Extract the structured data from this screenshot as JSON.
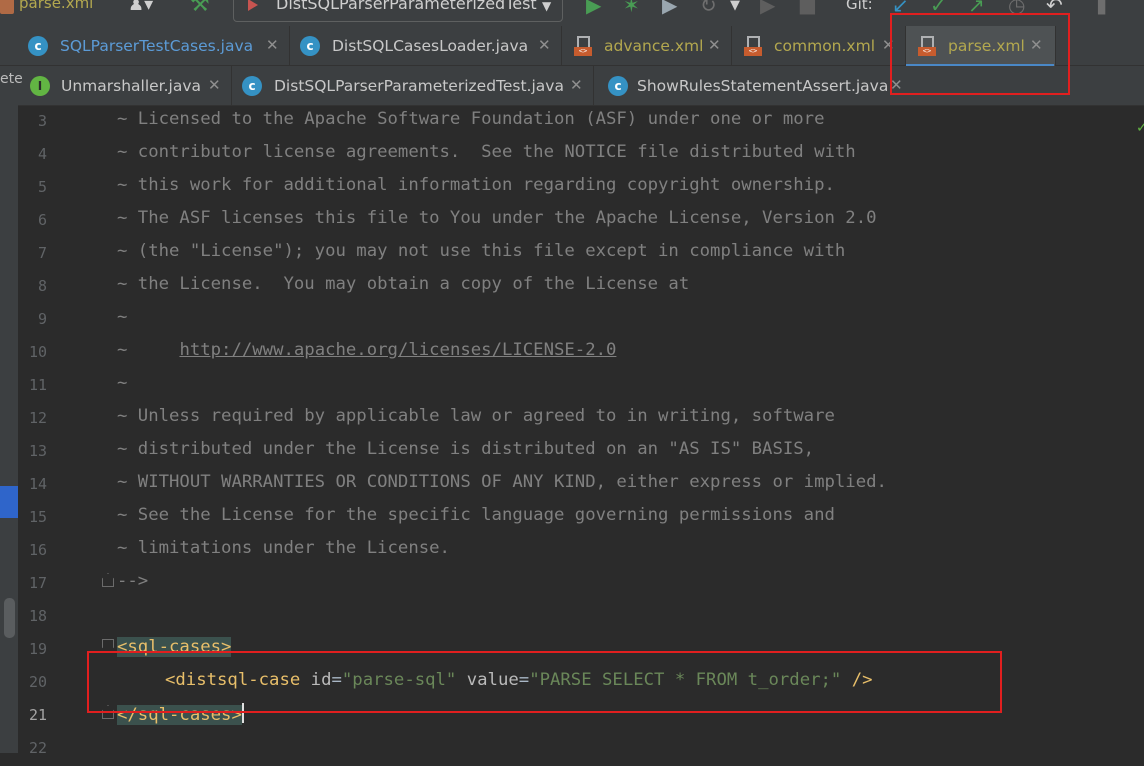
{
  "toolbar": {
    "file_label": "parse.xml",
    "run_config": "DistSQLParserParameterizedTest",
    "git_label": "Git:"
  },
  "tabs_row1": [
    {
      "label": "SQLParserTestCases.java",
      "icon": "java-class-icon",
      "color": "#5c9bd6"
    },
    {
      "label": "DistSQLCasesLoader.java",
      "icon": "java-class-icon",
      "color": "#c8c8c8"
    },
    {
      "label": "advance.xml",
      "icon": "xml-file-icon",
      "color": "#b3a84f"
    },
    {
      "label": "common.xml",
      "icon": "xml-file-icon",
      "color": "#b3a84f"
    },
    {
      "label": "parse.xml",
      "icon": "xml-file-icon",
      "color": "#b3a84f",
      "active": true
    }
  ],
  "tabs_row2": [
    {
      "label": "Unmarshaller.java",
      "icon": "java-interface-icon",
      "color": "#c8c8c8"
    },
    {
      "label": "DistSQLParserParameterizedTest.java",
      "icon": "java-test-class-icon",
      "color": "#c8c8c8"
    },
    {
      "label": "ShowRulesStatementAssert.java",
      "icon": "java-class-icon",
      "color": "#c8c8c8"
    }
  ],
  "side_strip_label": "ete",
  "editor": {
    "current_line": 21,
    "lines": [
      {
        "n": "3",
        "text": "~ Licensed to the Apache Software Foundation (ASF) under one or more"
      },
      {
        "n": "4",
        "text": "~ contributor license agreements.  See the NOTICE file distributed with"
      },
      {
        "n": "5",
        "text": "~ this work for additional information regarding copyright ownership."
      },
      {
        "n": "6",
        "text": "~ The ASF licenses this file to You under the Apache License, Version 2.0"
      },
      {
        "n": "7",
        "text": "~ (the \"License\"); you may not use this file except in compliance with"
      },
      {
        "n": "8",
        "text": "~ the License.  You may obtain a copy of the License at"
      },
      {
        "n": "9",
        "text": "~"
      },
      {
        "n": "10",
        "prefix": "~     ",
        "link": "http://www.apache.org/licenses/LICENSE-2.0"
      },
      {
        "n": "11",
        "text": "~"
      },
      {
        "n": "12",
        "text": "~ Unless required by applicable law or agreed to in writing, software"
      },
      {
        "n": "13",
        "text": "~ distributed under the License is distributed on an \"AS IS\" BASIS,"
      },
      {
        "n": "14",
        "text": "~ WITHOUT WARRANTIES OR CONDITIONS OF ANY KIND, either express or implied."
      },
      {
        "n": "15",
        "text": "~ See the License for the specific language governing permissions and"
      },
      {
        "n": "16",
        "text": "~ limitations under the License."
      },
      {
        "n": "17",
        "text": "-->"
      },
      {
        "n": "18",
        "text": ""
      },
      {
        "n": "19",
        "open_tag": "<sql-cases>"
      },
      {
        "n": "20",
        "case_open": "<distsql-case",
        "attr1": "id",
        "val1": "\"parse-sql\"",
        "attr2": "value",
        "val2": "\"PARSE SELECT * FROM t_order;\"",
        "case_close": "/>"
      },
      {
        "n": "21",
        "close_tag": "</sql-cases>"
      },
      {
        "n": "22",
        "text": ""
      }
    ]
  },
  "colors": {
    "highlight_box": "#e11f1f",
    "tag": "#e8bf6a",
    "string": "#6a8759",
    "comment": "#808080"
  }
}
